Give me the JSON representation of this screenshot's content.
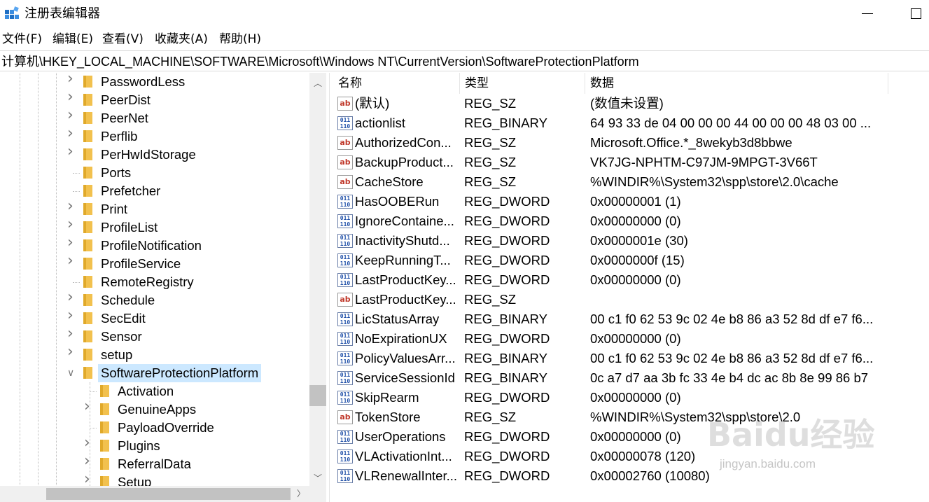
{
  "window": {
    "title": "注册表编辑器",
    "icon": "registry-editor-icon"
  },
  "menu": [
    "文件(F)",
    "编辑(E)",
    "查看(V)",
    "收藏夹(A)",
    "帮助(H)"
  ],
  "address": "计算机\\HKEY_LOCAL_MACHINE\\SOFTWARE\\Microsoft\\Windows NT\\CurrentVersion\\SoftwareProtectionPlatform",
  "tree": {
    "items": [
      {
        "label": "PasswordLess",
        "expandable": true
      },
      {
        "label": "PeerDist",
        "expandable": true
      },
      {
        "label": "PeerNet",
        "expandable": true
      },
      {
        "label": "Perflib",
        "expandable": true
      },
      {
        "label": "PerHwIdStorage",
        "expandable": true
      },
      {
        "label": "Ports",
        "expandable": false
      },
      {
        "label": "Prefetcher",
        "expandable": false
      },
      {
        "label": "Print",
        "expandable": true
      },
      {
        "label": "ProfileList",
        "expandable": true
      },
      {
        "label": "ProfileNotification",
        "expandable": true
      },
      {
        "label": "ProfileService",
        "expandable": true
      },
      {
        "label": "RemoteRegistry",
        "expandable": false
      },
      {
        "label": "Schedule",
        "expandable": true
      },
      {
        "label": "SecEdit",
        "expandable": true
      },
      {
        "label": "Sensor",
        "expandable": true
      },
      {
        "label": "setup",
        "expandable": true
      },
      {
        "label": "SoftwareProtectionPlatform",
        "expandable": true,
        "expanded": true,
        "selected": true
      },
      {
        "label": "Activation",
        "expandable": false,
        "child": true
      },
      {
        "label": "GenuineApps",
        "expandable": true,
        "child": true
      },
      {
        "label": "PayloadOverride",
        "expandable": false,
        "child": true
      },
      {
        "label": "Plugins",
        "expandable": true,
        "child": true
      },
      {
        "label": "ReferralData",
        "expandable": true,
        "child": true
      },
      {
        "label": "Setup",
        "expandable": true,
        "child": true
      }
    ]
  },
  "columns": {
    "name": "名称",
    "type": "类型",
    "data": "数据"
  },
  "values": [
    {
      "icon": "string-value-icon",
      "name": "(默认)",
      "type": "REG_SZ",
      "data": "(数值未设置)"
    },
    {
      "icon": "binary-value-icon",
      "name": "actionlist",
      "type": "REG_BINARY",
      "data": "64 93 33 de 04 00 00 00 44 00 00 00 48 03 00 ..."
    },
    {
      "icon": "string-value-icon",
      "name": "AuthorizedCon...",
      "type": "REG_SZ",
      "data": "Microsoft.Office.*_8wekyb3d8bbwe"
    },
    {
      "icon": "string-value-icon",
      "name": "BackupProduct...",
      "type": "REG_SZ",
      "data": "VK7JG-NPHTM-C97JM-9MPGT-3V66T"
    },
    {
      "icon": "string-value-icon",
      "name": "CacheStore",
      "type": "REG_SZ",
      "data": "%WINDIR%\\System32\\spp\\store\\2.0\\cache"
    },
    {
      "icon": "binary-value-icon",
      "name": "HasOOBERun",
      "type": "REG_DWORD",
      "data": "0x00000001 (1)"
    },
    {
      "icon": "binary-value-icon",
      "name": "IgnoreContaine...",
      "type": "REG_DWORD",
      "data": "0x00000000 (0)"
    },
    {
      "icon": "binary-value-icon",
      "name": "InactivityShutd...",
      "type": "REG_DWORD",
      "data": "0x0000001e (30)"
    },
    {
      "icon": "binary-value-icon",
      "name": "KeepRunningT...",
      "type": "REG_DWORD",
      "data": "0x0000000f (15)"
    },
    {
      "icon": "binary-value-icon",
      "name": "LastProductKey...",
      "type": "REG_DWORD",
      "data": "0x00000000 (0)"
    },
    {
      "icon": "string-value-icon",
      "name": "LastProductKey...",
      "type": "REG_SZ",
      "data": ""
    },
    {
      "icon": "binary-value-icon",
      "name": "LicStatusArray",
      "type": "REG_BINARY",
      "data": "00 c1 f0 62 53 9c 02 4e b8 86 a3 52 8d df e7 f6..."
    },
    {
      "icon": "binary-value-icon",
      "name": "NoExpirationUX",
      "type": "REG_DWORD",
      "data": "0x00000000 (0)"
    },
    {
      "icon": "binary-value-icon",
      "name": "PolicyValuesArr...",
      "type": "REG_BINARY",
      "data": "00 c1 f0 62 53 9c 02 4e b8 86 a3 52 8d df e7 f6..."
    },
    {
      "icon": "binary-value-icon",
      "name": "ServiceSessionId",
      "type": "REG_BINARY",
      "data": "0c a7 d7 aa 3b fc 33 4e b4 dc ac 8b 8e 99 86 b7"
    },
    {
      "icon": "binary-value-icon",
      "name": "SkipRearm",
      "type": "REG_DWORD",
      "data": "0x00000000 (0)"
    },
    {
      "icon": "string-value-icon",
      "name": "TokenStore",
      "type": "REG_SZ",
      "data": "%WINDIR%\\System32\\spp\\store\\2.0"
    },
    {
      "icon": "binary-value-icon",
      "name": "UserOperations",
      "type": "REG_DWORD",
      "data": "0x00000000 (0)"
    },
    {
      "icon": "binary-value-icon",
      "name": "VLActivationInt...",
      "type": "REG_DWORD",
      "data": "0x00000078 (120)"
    },
    {
      "icon": "binary-value-icon",
      "name": "VLRenewalInter...",
      "type": "REG_DWORD",
      "data": "0x00002760 (10080)"
    }
  ],
  "watermark": {
    "logo": "Baidu经验",
    "url": "jingyan.baidu.com"
  },
  "colors": {
    "selection": "#cce8ff",
    "folder": "#f2c14e",
    "scrollbar_track": "#f0f0f0"
  }
}
